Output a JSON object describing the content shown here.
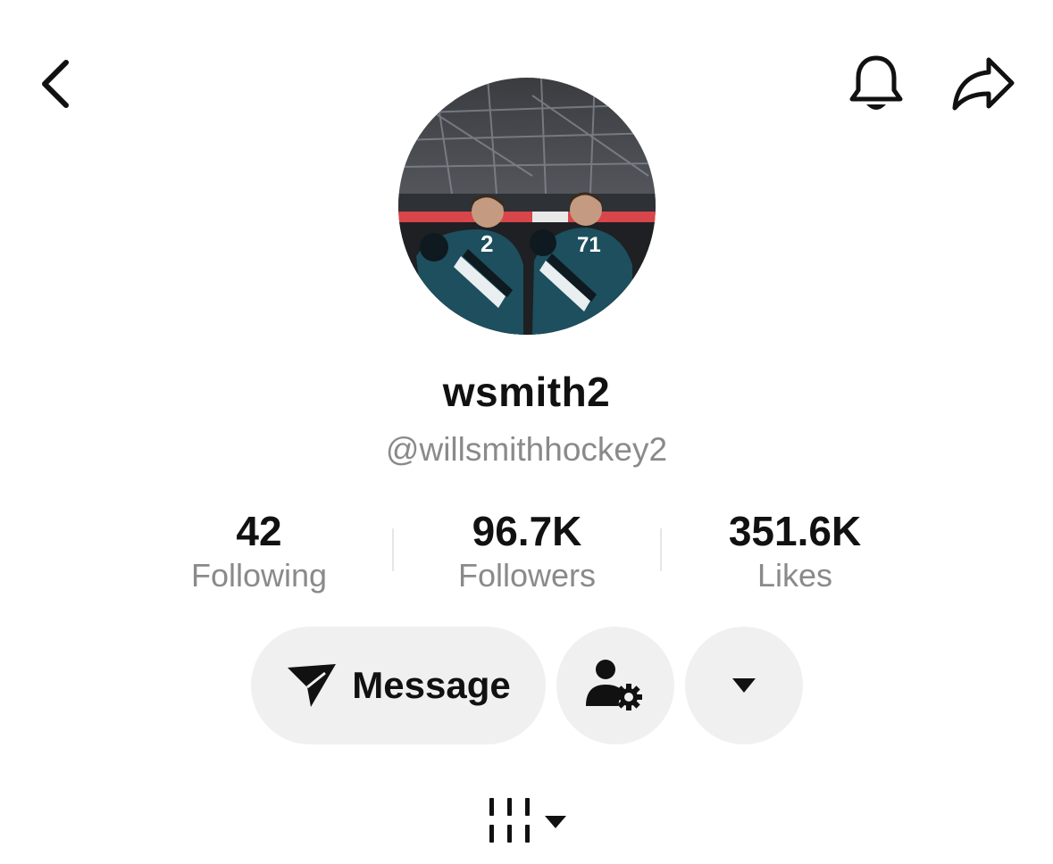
{
  "header": {
    "back_icon": "chevron-left-icon",
    "bell_icon": "bell-icon",
    "share_icon": "share-arrow-icon"
  },
  "profile": {
    "display_name": "wsmith2",
    "handle": "@willsmithhockey2",
    "avatar": "hockey-players-photo"
  },
  "stats": [
    {
      "value": "42",
      "label": "Following"
    },
    {
      "value": "96.7K",
      "label": "Followers"
    },
    {
      "value": "351.6K",
      "label": "Likes"
    }
  ],
  "actions": {
    "message_label": "Message",
    "message_icon": "send-icon",
    "manage_icon": "user-settings-icon",
    "more_icon": "caret-down-icon"
  },
  "tabs": {
    "grid_icon": "grid-tab-icon"
  },
  "colors": {
    "text": "#111111",
    "secondary": "#8a8a8a",
    "pill_bg": "#f0f0f0",
    "jersey_teal": "#1d4f5e"
  }
}
